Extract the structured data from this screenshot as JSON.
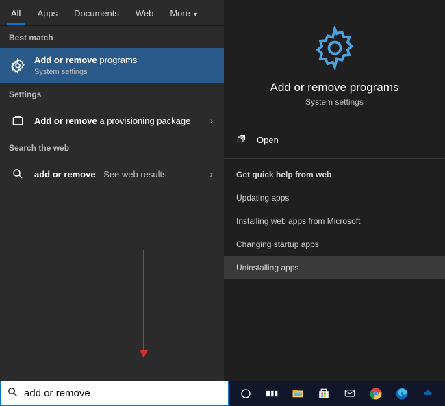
{
  "tabs": {
    "all": "All",
    "apps": "Apps",
    "documents": "Documents",
    "web": "Web",
    "more": "More"
  },
  "sections": {
    "bestMatch": "Best match",
    "settings": "Settings",
    "searchWeb": "Search the web"
  },
  "results": {
    "bestMatch": {
      "bold": "Add or remove",
      "rest": " programs",
      "sub": "System settings"
    },
    "settings": {
      "bold": "Add or remove",
      "rest": " a provisioning package"
    },
    "web": {
      "bold": "add or remove",
      "rest": " - See web results"
    }
  },
  "detail": {
    "title": "Add or remove programs",
    "sub": "System settings",
    "open": "Open",
    "helpTitle": "Get quick help from web",
    "helpItems": [
      "Updating apps",
      "Installing web apps from Microsoft",
      "Changing startup apps",
      "Uninstalling apps"
    ]
  },
  "search": {
    "value": "add or remove"
  }
}
